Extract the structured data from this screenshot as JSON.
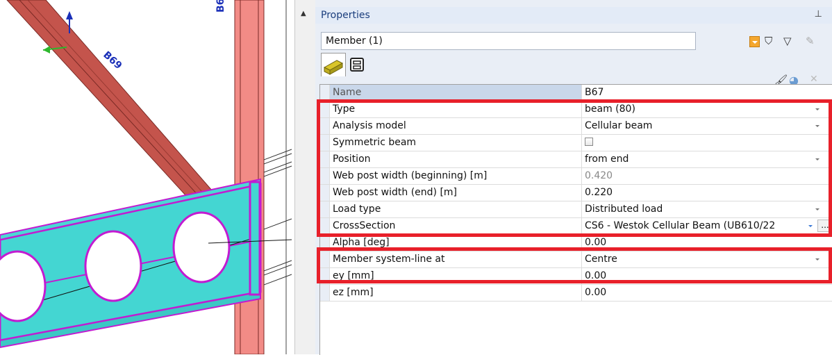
{
  "viewport": {
    "labels": [
      "B69",
      "B6"
    ]
  },
  "panel": {
    "title": "Properties",
    "member_label": "Member (1)"
  },
  "properties": [
    {
      "key": "name",
      "name": "Name",
      "value": "B67",
      "control": "none"
    },
    {
      "key": "type",
      "name": "Type",
      "value": "beam (80)",
      "control": "dropdown"
    },
    {
      "key": "analysis",
      "name": "Analysis model",
      "value": "Cellular beam",
      "control": "dropdown"
    },
    {
      "key": "symmetric",
      "name": "Symmetric beam",
      "value": "",
      "control": "checkbox"
    },
    {
      "key": "position",
      "name": "Position",
      "value": "from end",
      "control": "dropdown"
    },
    {
      "key": "webpost_begin",
      "name": "Web post width (beginning) [m]",
      "value": "0.420",
      "control": "none"
    },
    {
      "key": "webpost_end",
      "name": "Web post width (end) [m]",
      "value": "0.220",
      "control": "none"
    },
    {
      "key": "loadtype",
      "name": "Load type",
      "value": "Distributed load",
      "control": "dropdown"
    },
    {
      "key": "crosssection",
      "name": "CrossSection",
      "value": "CS6 - Westok Cellular Beam (UB610/22",
      "control": "dropdown-ellipsis"
    },
    {
      "key": "alpha",
      "name": "Alpha [deg]",
      "value": "0.00",
      "control": "none"
    },
    {
      "key": "systemline",
      "name": "Member system-line at",
      "value": "Centre",
      "control": "dropdown"
    },
    {
      "key": "ey",
      "name": "ey [mm]",
      "value": "0.00",
      "control": "none"
    },
    {
      "key": "ez",
      "name": "ez [mm]",
      "value": "0.00",
      "control": "none"
    }
  ],
  "ellipsis_label": "..."
}
